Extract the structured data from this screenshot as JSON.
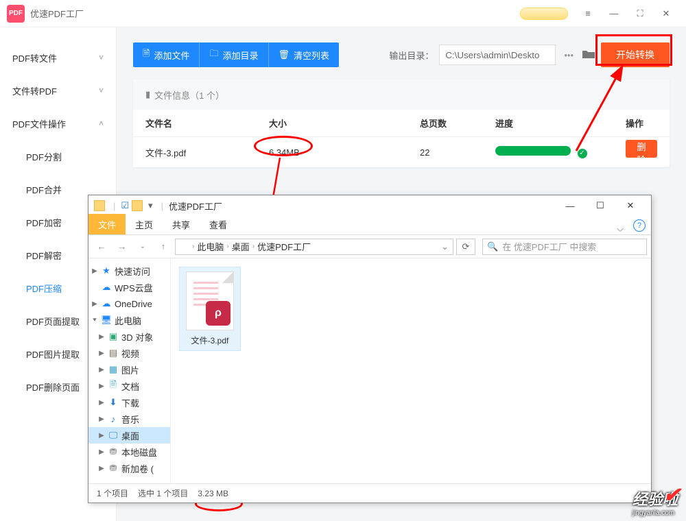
{
  "titlebar": {
    "app_name": "优速PDF工厂"
  },
  "sidebar": {
    "items": [
      {
        "label": "PDF转文件",
        "expandable": true,
        "open": false
      },
      {
        "label": "文件转PDF",
        "expandable": true,
        "open": false
      },
      {
        "label": "PDF文件操作",
        "expandable": true,
        "open": true
      },
      {
        "label": "PDF分割",
        "minor": true
      },
      {
        "label": "PDF合并",
        "minor": true
      },
      {
        "label": "PDF加密",
        "minor": true
      },
      {
        "label": "PDF解密",
        "minor": true
      },
      {
        "label": "PDF压缩",
        "minor": true,
        "active": true
      },
      {
        "label": "PDF页面提取",
        "minor": true
      },
      {
        "label": "PDF图片提取",
        "minor": true
      },
      {
        "label": "PDF删除页面",
        "minor": true
      }
    ]
  },
  "toolbar": {
    "add_file": "添加文件",
    "add_dir": "添加目录",
    "clear": "清空列表",
    "out_label": "输出目录：",
    "out_path": "C:\\Users\\admin\\Deskto",
    "start": "开始转换"
  },
  "panel": {
    "info_label": "文件信息（1 个）",
    "headers": {
      "name": "文件名",
      "size": "大小",
      "pages": "总页数",
      "progress": "进度",
      "action": "操作"
    },
    "rows": [
      {
        "name": "文件-3.pdf",
        "size": "6.34MB",
        "pages": "22",
        "action": "删除"
      }
    ]
  },
  "explorer": {
    "window_title": "优速PDF工厂",
    "ribbon": {
      "file": "文件",
      "home": "主页",
      "share": "共享",
      "view": "查看"
    },
    "crumbs": [
      "此电脑",
      "桌面",
      "优速PDF工厂"
    ],
    "search_placeholder": "在 优速PDF工厂 中搜索",
    "tree": [
      {
        "label": "快速访问",
        "icon": "star",
        "color": "#1e88ff",
        "caret": "▶"
      },
      {
        "label": "WPS云盘",
        "icon": "cloud",
        "color": "#1e88ff",
        "caret": ""
      },
      {
        "label": "OneDrive",
        "icon": "cloud",
        "color": "#1e88ff",
        "caret": "▶"
      },
      {
        "label": "此电脑",
        "icon": "pc",
        "color": "#1e88ff",
        "caret": "⯆"
      },
      {
        "label": "3D 对象",
        "icon": "cube",
        "color": "#2aa775",
        "caret": "▶",
        "indent": true
      },
      {
        "label": "视频",
        "icon": "video",
        "color": "#7e6b57",
        "caret": "▶",
        "indent": true
      },
      {
        "label": "图片",
        "icon": "image",
        "color": "#3aa0c9",
        "caret": "▶",
        "indent": true
      },
      {
        "label": "文档",
        "icon": "doc",
        "color": "#3aa0c9",
        "caret": "▶",
        "indent": true
      },
      {
        "label": "下载",
        "icon": "download",
        "color": "#2b7cd3",
        "caret": "▶",
        "indent": true
      },
      {
        "label": "音乐",
        "icon": "music",
        "color": "#2b7cd3",
        "caret": "▶",
        "indent": true
      },
      {
        "label": "桌面",
        "icon": "desktop",
        "color": "#2b7cd3",
        "caret": "▶",
        "indent": true,
        "selected": true
      },
      {
        "label": "本地磁盘",
        "icon": "disk",
        "color": "#888",
        "caret": "▶",
        "indent": true
      },
      {
        "label": "新加卷 (",
        "icon": "disk",
        "color": "#888",
        "caret": "▶",
        "indent": true
      }
    ],
    "file": {
      "name": "文件-3.pdf",
      "badge": "ρ"
    },
    "status": {
      "count": "1 个项目",
      "selected": "选中 1 个项目",
      "size": "3.23 MB"
    }
  },
  "brand": {
    "text": "经验啦",
    "url": "jingyanla.com"
  }
}
